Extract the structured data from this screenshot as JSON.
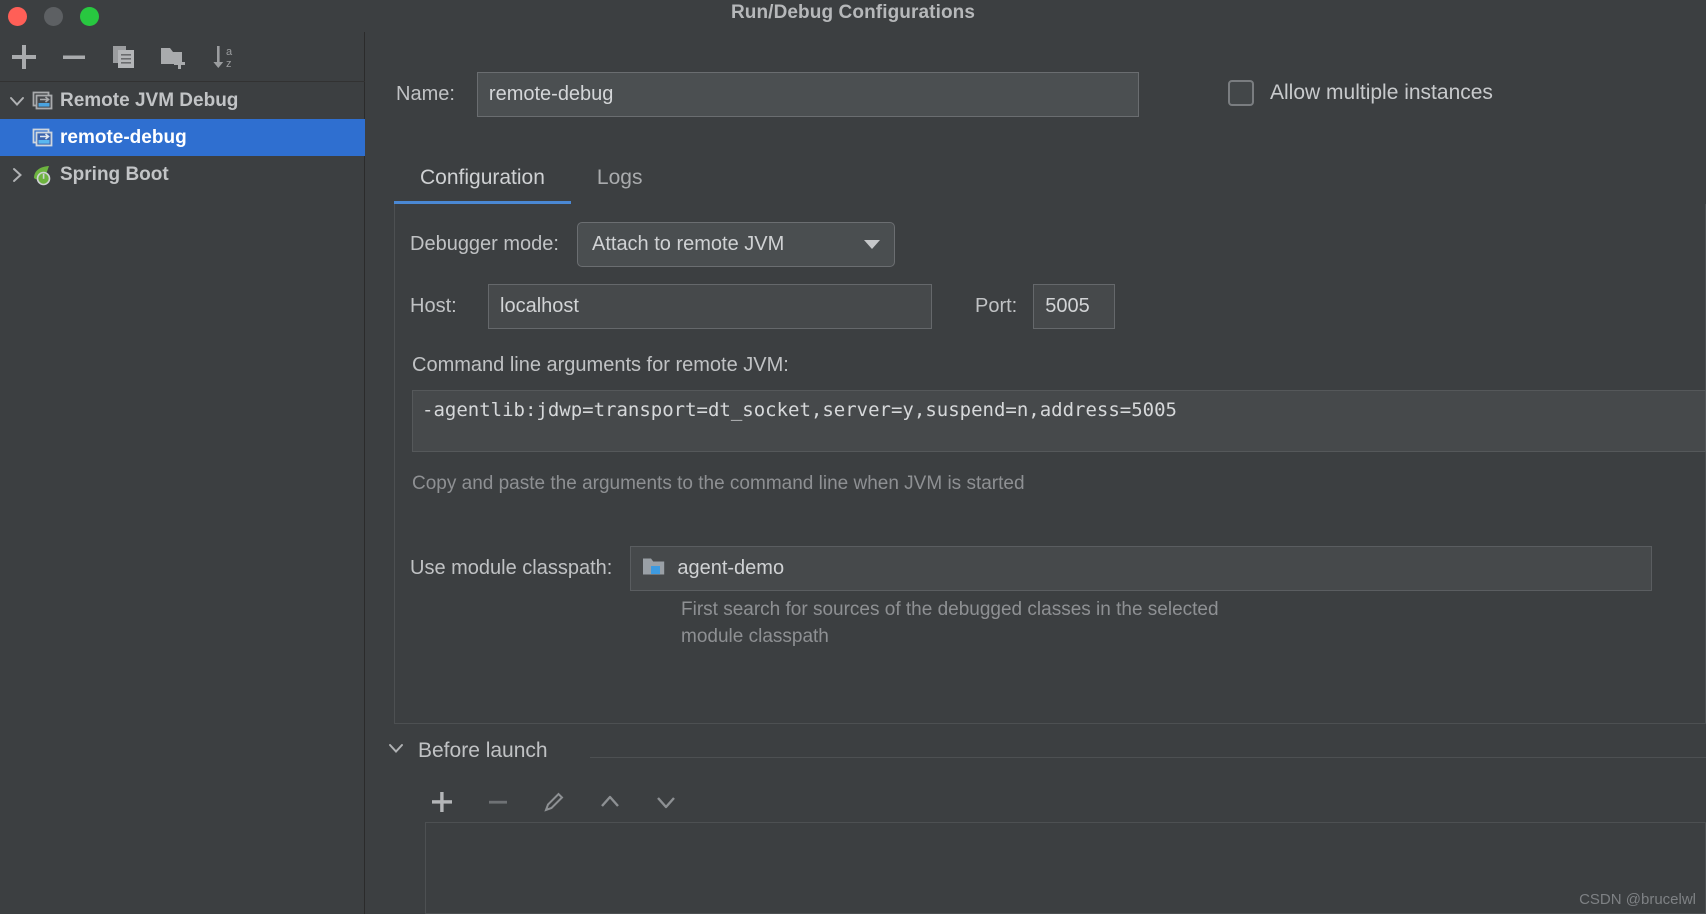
{
  "window": {
    "title": "Run/Debug Configurations",
    "traffic_lights": [
      "close",
      "minimize",
      "zoom"
    ]
  },
  "sidebar": {
    "toolbar": [
      {
        "name": "add-configuration-button",
        "icon": "plus-icon",
        "label": "+"
      },
      {
        "name": "remove-configuration-button",
        "icon": "minus-icon",
        "label": "−"
      },
      {
        "name": "copy-configuration-button",
        "icon": "copy-icon",
        "label": "Copy"
      },
      {
        "name": "save-configuration-button",
        "icon": "folder-plus-icon",
        "label": "Save configuration"
      },
      {
        "name": "sort-configurations-button",
        "icon": "sort-alpha-icon",
        "label": "Sort"
      }
    ],
    "tree": [
      {
        "label": "Remote JVM Debug",
        "icon": "remote-jvm-debug-icon",
        "expanded": true,
        "selected": false,
        "arrow": "chevron-down-icon"
      },
      {
        "label": "remote-debug",
        "icon": "remote-jvm-debug-icon",
        "expanded": false,
        "selected": true,
        "arrow": "none"
      },
      {
        "label": "Spring Boot",
        "icon": "spring-boot-icon",
        "expanded": false,
        "selected": false,
        "arrow": "chevron-right-icon"
      }
    ]
  },
  "form": {
    "name_label": "Name:",
    "name_value": "remote-debug",
    "allow_multiple_label": "Allow multiple instances",
    "allow_multiple_checked": false,
    "tabs": [
      {
        "label": "Configuration",
        "active": true
      },
      {
        "label": "Logs",
        "active": false
      }
    ],
    "debugger_mode_label": "Debugger mode:",
    "debugger_mode_value": "Attach to remote JVM",
    "host_label": "Host:",
    "host_value": "localhost",
    "port_label": "Port:",
    "port_value": "5005",
    "args_label": "Command line arguments for remote JVM:",
    "args_value": "-agentlib:jdwp=transport=dt_socket,server=y,suspend=n,address=5005",
    "args_hint": "Copy and paste the arguments to the command line when JVM is started",
    "classpath_label": "Use module classpath:",
    "classpath_value": "agent-demo",
    "classpath_hint_line1": "First search for sources of the debugged classes in the selected",
    "classpath_hint_line2": "module classpath"
  },
  "before_launch": {
    "title": "Before launch",
    "expanded": true,
    "arrow": "chevron-down-icon",
    "toolbar": [
      {
        "name": "before-launch-add-button",
        "icon": "plus-icon"
      },
      {
        "name": "before-launch-remove-button",
        "icon": "minus-icon"
      },
      {
        "name": "before-launch-edit-button",
        "icon": "pencil-icon"
      },
      {
        "name": "before-launch-move-up-button",
        "icon": "arrow-up-icon"
      },
      {
        "name": "before-launch-move-down-button",
        "icon": "arrow-down-icon"
      }
    ]
  },
  "watermark": "CSDN @brucelwl",
  "colors": {
    "background": "#3c3f41",
    "selection": "#2f6fd0",
    "accent": "#4a88d4",
    "text": "#c0c2c4",
    "muted": "#8e9093",
    "traffic_red": "#ff5f57",
    "traffic_yellow": "#5d6063",
    "traffic_green": "#28c840"
  }
}
